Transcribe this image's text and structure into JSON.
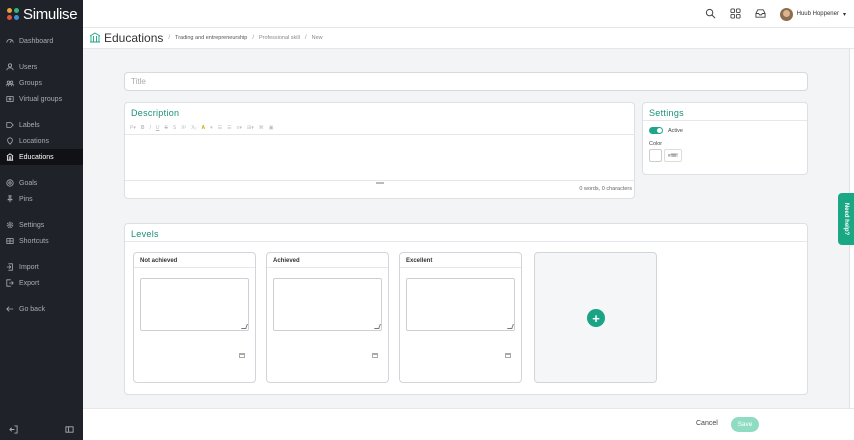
{
  "app": {
    "name": "Simulise"
  },
  "sidebar": {
    "items": [
      {
        "label": "Dashboard",
        "icon": "dashboard-icon"
      },
      {
        "label": "Users",
        "icon": "user-icon"
      },
      {
        "label": "Groups",
        "icon": "groups-icon"
      },
      {
        "label": "Virtual groups",
        "icon": "virtual-groups-icon"
      },
      {
        "label": "Labels",
        "icon": "label-icon"
      },
      {
        "label": "Locations",
        "icon": "location-icon"
      },
      {
        "label": "Educations",
        "icon": "education-icon"
      },
      {
        "label": "Goals",
        "icon": "goal-icon"
      },
      {
        "label": "Pins",
        "icon": "pin-icon"
      },
      {
        "label": "Settings",
        "icon": "gear-icon"
      },
      {
        "label": "Shortcuts",
        "icon": "shortcut-icon"
      },
      {
        "label": "Import",
        "icon": "import-icon"
      },
      {
        "label": "Export",
        "icon": "export-icon"
      },
      {
        "label": "Go back",
        "icon": "arrow-left-icon"
      }
    ],
    "active": "Educations"
  },
  "topbar": {
    "user_name": "Huub Hoppener"
  },
  "breadcrumb": {
    "title": "Educations",
    "items": [
      "Trading and entrepreneurship",
      "Professional skill",
      "New"
    ]
  },
  "form": {
    "title_placeholder": "Title",
    "description": {
      "heading": "Description",
      "word_count": "0 words, 0 characters"
    },
    "settings": {
      "heading": "Settings",
      "active_label": "Active",
      "color_label": "Color",
      "color_value": "#ffffff"
    },
    "levels": {
      "heading": "Levels",
      "items": [
        "Not achieved",
        "Achieved",
        "Excellent"
      ]
    }
  },
  "footer": {
    "cancel_label": "Cancel",
    "save_label": "Save"
  },
  "help": {
    "label": "Need help?"
  },
  "colors": {
    "accent": "#1aa384",
    "sidebar_bg": "#1f2329"
  }
}
